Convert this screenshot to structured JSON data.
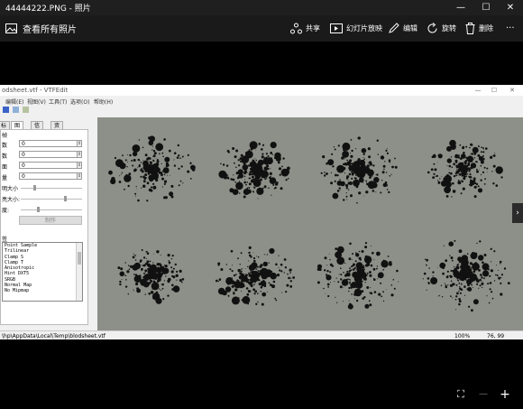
{
  "window": {
    "title": "44444222.PNG - 照片",
    "minimize": "—",
    "maximize": "☐",
    "close": "✕"
  },
  "commandbar": {
    "back_label": "查看所有照片",
    "share": "共享",
    "slideshow": "幻灯片放映",
    "edit": "编辑",
    "rotate": "旋转",
    "delete": "删除",
    "more": "···"
  },
  "vtfedit": {
    "title": "odsheet.vtf - VTFEdit",
    "menu": [
      "编辑(E)",
      "视图(V)",
      "工具(T)",
      "选项(O)",
      "帮助(H)"
    ],
    "tabs": [
      "标签",
      "图像",
      "信息",
      "资源"
    ],
    "fields": [
      {
        "label": "帧",
        "value": ""
      },
      {
        "label": "数",
        "value": "0"
      },
      {
        "label": "数",
        "value": "0"
      },
      {
        "label": "面",
        "value": "0"
      },
      {
        "label": "量",
        "value": "0"
      }
    ],
    "spins": [
      "0",
      "0",
      "0",
      "0"
    ],
    "sliders": [
      "明大小",
      "亮大小:",
      "度:"
    ],
    "generate_button": "制作",
    "flags_label": "签",
    "flags": [
      "Point Sample",
      "Trilinear",
      "Clamp S",
      "Clamp T",
      "Anisotropic",
      "Hint DXT5",
      "SRGB",
      "Normal Map",
      "No Mipmap"
    ],
    "status_path": "\\hp\\AppData\\Local\\Temp\\blodsheet.vtf",
    "status_zoom": "100%",
    "status_coords": "76, 99"
  },
  "nav": {
    "next_arrow": "›"
  },
  "zoom": {
    "fit": "⛶",
    "zoom_out": "—",
    "zoom_in": "+"
  },
  "colors": {
    "photos_bg": "#000000",
    "titlebar": "#1f1f1f",
    "viewport_bg": "#8d9088",
    "splatter": "#111111"
  }
}
